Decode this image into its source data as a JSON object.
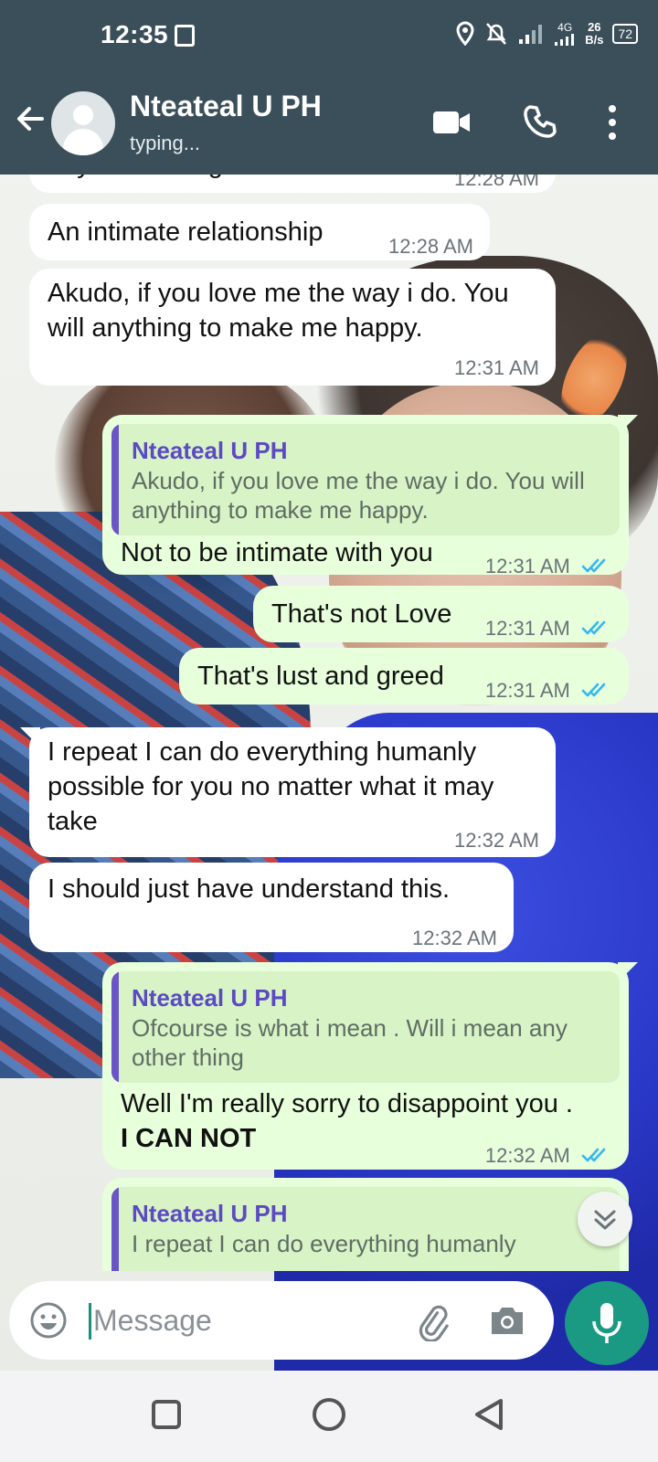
{
  "status_bar": {
    "time": "12:35",
    "network": "4G",
    "data_rate": "26",
    "data_rate_unit": "B/s",
    "battery": "72"
  },
  "chat_header": {
    "contact_name": "Nteateal U PH",
    "contact_status": "typing..."
  },
  "messages": [
    {
      "direction": "in",
      "text": "any other thing",
      "time": "12:28 AM"
    },
    {
      "direction": "in",
      "text": "An intimate relationship",
      "time": "12:28 AM"
    },
    {
      "direction": "in",
      "text": "Akudo, if you love me the way i do. You will anything to make me happy.",
      "time": "12:31 AM"
    },
    {
      "direction": "out",
      "quote_name": "Nteateal U PH",
      "quote_text": "Akudo, if you love me the way i do. You will anything to make me happy.",
      "text": "Not to be intimate with you",
      "time": "12:31 AM"
    },
    {
      "direction": "out",
      "text": "That's not Love",
      "time": "12:31 AM"
    },
    {
      "direction": "out",
      "text": "That's lust and greed",
      "time": "12:31 AM"
    },
    {
      "direction": "in",
      "text": "I repeat I can do everything humanly possible for you no matter what it may take",
      "time": "12:32 AM"
    },
    {
      "direction": "in",
      "text": "I should just have understand this.",
      "time": "12:32 AM"
    },
    {
      "direction": "out",
      "quote_name": "Nteateal U PH",
      "quote_text": "Ofcourse is what i mean . Will i mean any other thing",
      "text": "Well I'm really sorry to disappoint you . ",
      "text_bold": "I CAN NOT",
      "time": "12:32 AM"
    },
    {
      "direction": "out",
      "quote_name": "Nteateal U PH",
      "quote_text": "I repeat I can do everything humanly"
    }
  ],
  "composer": {
    "placeholder": "Message"
  },
  "colors": {
    "header": "#3b4f5b",
    "outgoing_bubble": "#e7ffdb",
    "incoming_bubble": "#ffffff",
    "accent": "#1a9a83",
    "read_ticks": "#34b7f1",
    "quote_name": "#5c4ac2"
  },
  "icons": [
    "back-arrow-icon",
    "video-call-icon",
    "voice-call-icon",
    "more-options-icon",
    "double-check-icon",
    "scroll-down-chevron-icon",
    "emoji-icon",
    "attach-icon",
    "camera-icon",
    "mic-icon"
  ]
}
